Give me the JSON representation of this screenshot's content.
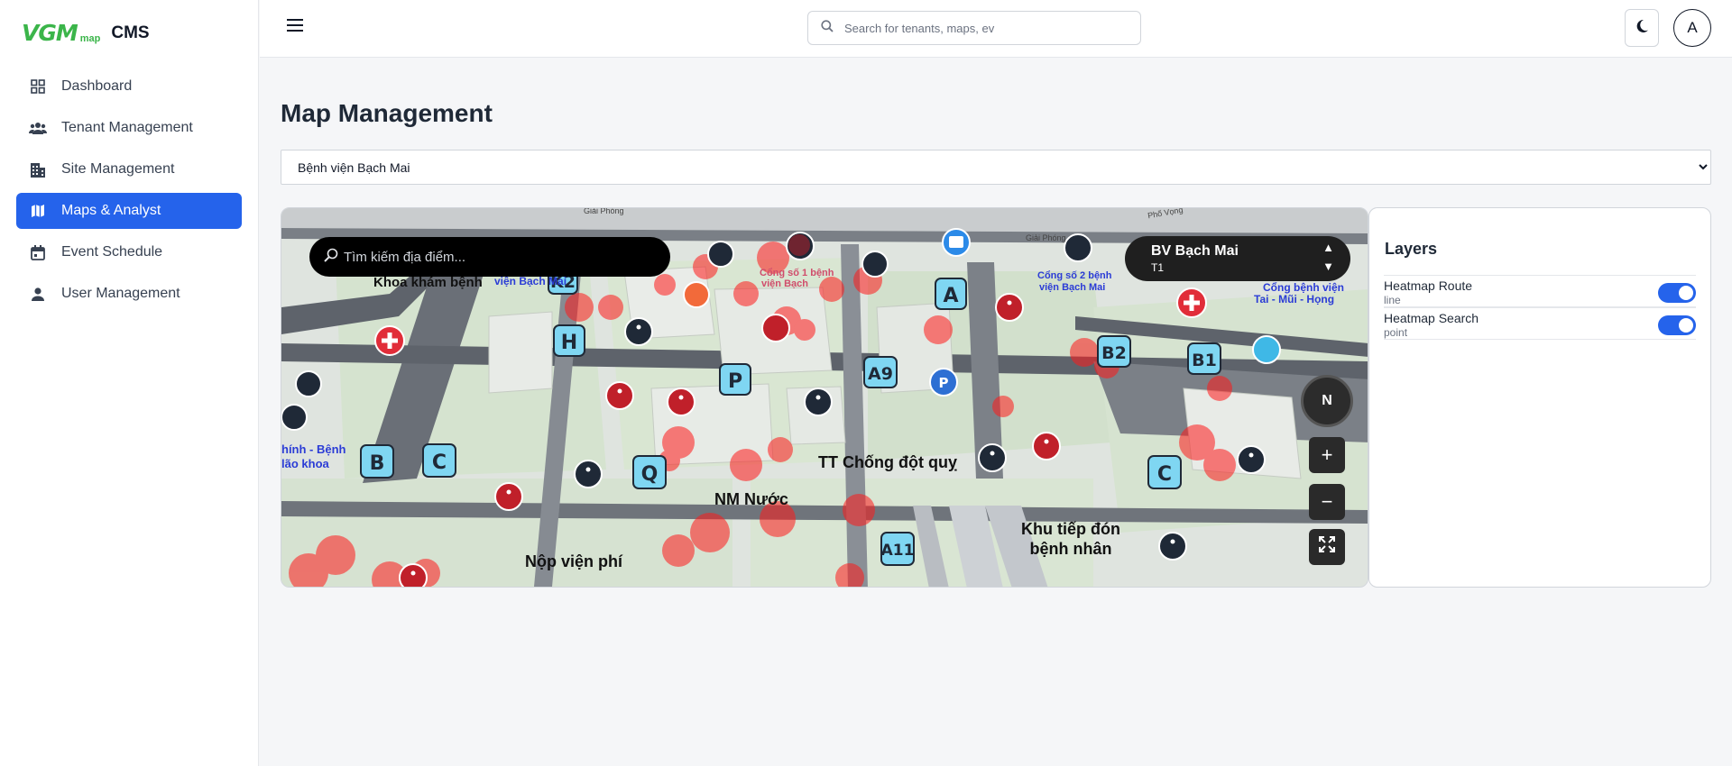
{
  "brand": {
    "logo_text": "VGM",
    "logo_sub": "map",
    "app_name": "CMS",
    "accent": "#2563eb",
    "logo_color": "#3bb54a"
  },
  "sidebar": {
    "items": [
      {
        "label": "Dashboard",
        "icon": "grid-icon",
        "active": false
      },
      {
        "label": "Tenant Management",
        "icon": "users-icon",
        "active": false
      },
      {
        "label": "Site Management",
        "icon": "building-icon",
        "active": false
      },
      {
        "label": "Maps & Analyst",
        "icon": "map-icon",
        "active": true
      },
      {
        "label": "Event Schedule",
        "icon": "calendar-icon",
        "active": false
      },
      {
        "label": "User Management",
        "icon": "person-icon",
        "active": false
      }
    ]
  },
  "header": {
    "search_placeholder": "Search for tenants, maps, ev",
    "theme_icon": "moon-icon",
    "avatar_initial": "A"
  },
  "main": {
    "title": "Map Management",
    "site_select": {
      "selected": "Bệnh viện Bạch Mai"
    }
  },
  "map": {
    "search_placeholder": "Tìm kiếm địa điểm...",
    "building_name": "BV Bạch Mai",
    "floor": "T1",
    "compass_label": "N",
    "zoom_in": "+",
    "zoom_out": "−",
    "labels": {
      "khoa_kham_benh": "Khoa khám bệnh",
      "vien_bach_mai": "viện Bạch Mai",
      "cong_so_1_a": "Cổng số 1 bệnh",
      "cong_so_1_b": "viện Bạch",
      "cong_so_2_a": "Cổng số 2 bệnh",
      "cong_so_2_b": "viện Bạch Mai",
      "cong_tmh_a": "Cổng bệnh viện",
      "cong_tmh_b": "Tai - Mũi - Họng",
      "left_a": "hính - Bệnh",
      "left_b": "lão khoa",
      "tt_chong_dot_quy": "TT Chống đột quỵ",
      "nm_nuoc": "NM Nước",
      "khu_tiep_don_a": "Khu tiếp đón",
      "khu_tiep_don_b": "bệnh nhân",
      "nop_vien_phi": "Nộp viện phí",
      "road_1": "Giải Phóng",
      "road_2": "Phố Vọng",
      "road_3": "Giải Phóng"
    },
    "building_codes": [
      "K2",
      "H",
      "P",
      "A9",
      "A",
      "B2",
      "B1",
      "B",
      "C",
      "Q",
      "A11",
      "C"
    ]
  },
  "layers": {
    "title": "Layers",
    "items": [
      {
        "name": "Heatmap Route",
        "type": "line",
        "enabled": true
      },
      {
        "name": "Heatmap Search",
        "type": "point",
        "enabled": true
      }
    ]
  }
}
